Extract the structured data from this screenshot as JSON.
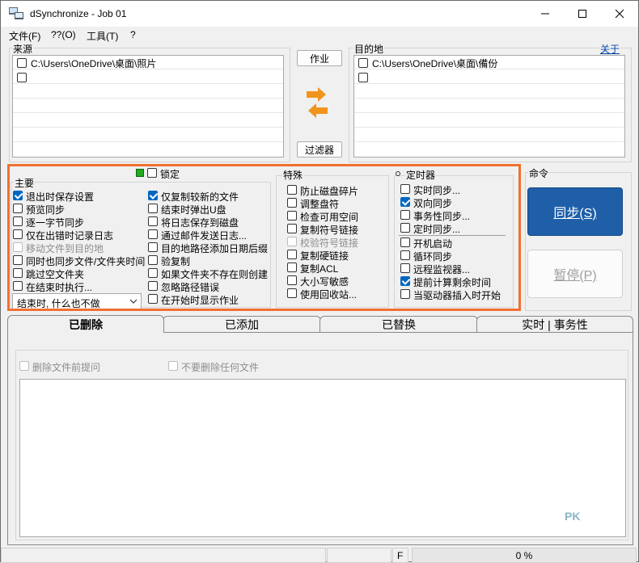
{
  "window": {
    "title": "dSynchronize - Job 01"
  },
  "menu": [
    "文件(F)",
    "??(O)",
    "工具(T)",
    "?"
  ],
  "source": {
    "label": "来源",
    "rows": [
      {
        "text": "C:\\Users\\OneDrive\\桌面\\照片",
        "checked": false
      },
      {
        "text": "",
        "checked": false
      }
    ]
  },
  "dest": {
    "label": "目的地",
    "about": "关于",
    "rows": [
      {
        "text": "C:\\Users\\OneDrive\\桌面\\備份",
        "checked": false
      },
      {
        "text": "",
        "checked": false
      }
    ]
  },
  "buttons": {
    "job": "作业",
    "filter": "过滤器",
    "sync": "同步(S)",
    "pause": "暂停(P)"
  },
  "main": {
    "label": "主要",
    "lock": "锁定",
    "left": [
      {
        "text": "退出时保存设置",
        "checked": true,
        "disabled": false
      },
      {
        "text": "预览同步",
        "checked": false,
        "disabled": false
      },
      {
        "text": "逐一字节同步",
        "checked": false,
        "disabled": false
      },
      {
        "text": "仅在出错时记录日志",
        "checked": false,
        "disabled": false
      },
      {
        "text": "移动文件到目的地",
        "checked": false,
        "disabled": true
      },
      {
        "text": "同时也同步文件/文件夹时间",
        "checked": false,
        "disabled": false
      },
      {
        "text": "跳过空文件夹",
        "checked": false,
        "disabled": false
      },
      {
        "text": "在结束时执行...",
        "checked": false,
        "disabled": false
      }
    ],
    "right": [
      {
        "text": "仅复制较新的文件",
        "checked": true,
        "disabled": false
      },
      {
        "text": "结束时弹出U盘",
        "checked": false,
        "disabled": false
      },
      {
        "text": "将日志保存到磁盘",
        "checked": false,
        "disabled": false
      },
      {
        "text": "通过邮件发送日志...",
        "checked": false,
        "disabled": false
      },
      {
        "text": "目的地路径添加日期后缀",
        "checked": false,
        "disabled": false
      },
      {
        "text": "验复制",
        "checked": false,
        "disabled": false
      },
      {
        "text": "如果文件夹不存在则创建",
        "checked": false,
        "disabled": false
      },
      {
        "text": "忽略路径错误",
        "checked": false,
        "disabled": false
      },
      {
        "text": "在开始时显示作业",
        "checked": false,
        "disabled": false
      }
    ],
    "end_action": "结束时, 什么也不做"
  },
  "special": {
    "label": "特殊",
    "items": [
      {
        "text": "防止磁盘碎片",
        "checked": false,
        "disabled": false
      },
      {
        "text": "调整盘符",
        "checked": false,
        "disabled": false
      },
      {
        "text": "检查可用空间",
        "checked": false,
        "disabled": false
      },
      {
        "text": "复制符号链接",
        "checked": false,
        "disabled": false
      },
      {
        "text": "校验符号链接",
        "checked": false,
        "disabled": true
      },
      {
        "text": "复制硬链接",
        "checked": false,
        "disabled": false
      },
      {
        "text": "复制ACL",
        "checked": false,
        "disabled": false
      },
      {
        "text": "大小写敏感",
        "checked": false,
        "disabled": false
      },
      {
        "text": "使用回收站...",
        "checked": false,
        "disabled": false
      }
    ]
  },
  "timer": {
    "label": "定时器",
    "items": [
      {
        "text": "实时同步...",
        "checked": false
      },
      {
        "text": "双向同步",
        "checked": true
      },
      {
        "text": "事务性同步...",
        "checked": false
      },
      {
        "text": "定时同步...",
        "checked": false
      }
    ],
    "items2": [
      {
        "text": "开机启动",
        "checked": false
      },
      {
        "text": "循环同步",
        "checked": false
      },
      {
        "text": "远程监视器...",
        "checked": false
      },
      {
        "text": "提前计算剩余时间",
        "checked": true
      },
      {
        "text": "当驱动器插入时开始",
        "checked": false
      }
    ]
  },
  "command": {
    "label": "命令"
  },
  "tabs": [
    "已删除",
    "已添加",
    "已替换",
    "实时 | 事务性"
  ],
  "deleted_tab": {
    "opt1": "删除文件前提问",
    "opt2": "不要删除任何文件"
  },
  "watermark": "PK",
  "status": {
    "flag": "F",
    "progress": 0,
    "progress_text": "0 %"
  },
  "colors": {
    "highlight": "#f07030",
    "sync_button": "#1f5fa8",
    "checkbox": "#0067c0",
    "arrow": "#f0941c"
  }
}
